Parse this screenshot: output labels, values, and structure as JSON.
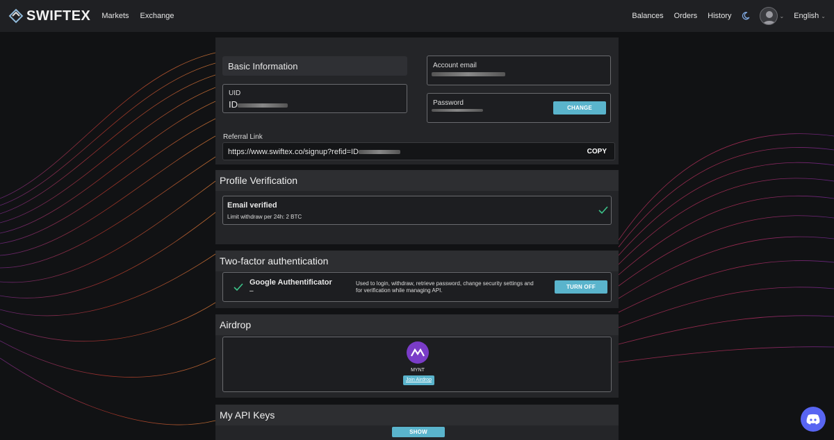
{
  "brand": {
    "name": "SWIFTEX"
  },
  "nav": {
    "left": [
      "Markets",
      "Exchange"
    ],
    "right": [
      "Balances",
      "Orders",
      "History"
    ],
    "language": "English"
  },
  "basic": {
    "title": "Basic Information",
    "uid_label": "UID",
    "uid_value": "ID",
    "email_label": "Account email",
    "password_label": "Password",
    "change_button": "CHANGE",
    "referral_label": "Referral Link",
    "referral_value": "https://www.swiftex.co/signup?refid=ID",
    "copy_button": "COPY"
  },
  "verification": {
    "title": "Profile Verification",
    "status": "Email verified",
    "limit": "Limit withdraw per 24h: 2 BTC"
  },
  "twofa": {
    "title": "Two-factor authentication",
    "method": "Google Authentificator",
    "method_sub": "–",
    "description": "Used to login, withdraw, retrieve password, change security settings and for verification while managing API.",
    "button": "TURN OFF"
  },
  "airdrop": {
    "title": "Airdrop",
    "token": "MYNT",
    "join": "Join Airdrop"
  },
  "api": {
    "title": "My API Keys",
    "show_button": "SHOW"
  },
  "colors": {
    "accent": "#5ab4cc",
    "check": "#3cc48a",
    "panel": "#242528",
    "header": "#1f2023"
  }
}
